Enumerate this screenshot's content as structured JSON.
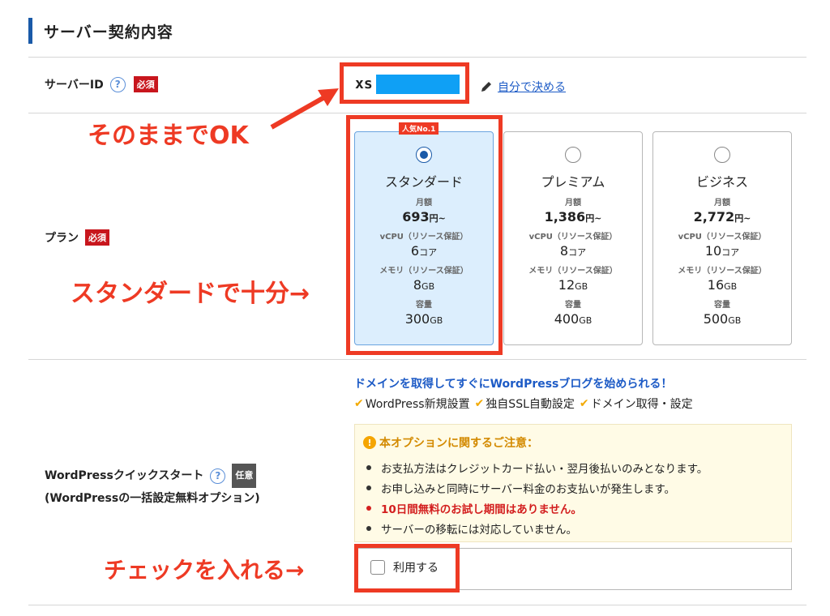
{
  "section": {
    "title": "サーバー契約内容"
  },
  "server_id": {
    "label": "サーバーID",
    "help_icon": "question-circle-icon",
    "required_badge": "必須",
    "value": "xs",
    "edit_link": "自分で決める",
    "edit_icon": "pencil-icon"
  },
  "plan": {
    "label": "プラン",
    "required_badge": "必須",
    "popular_badge": "人気No.1",
    "price_label": "月額",
    "cpu_label": "vCPU（リソース保証）",
    "memory_label": "メモリ（リソース保証）",
    "storage_label": "容量",
    "options": [
      {
        "name": "スタンダード",
        "price": "693",
        "price_unit": "円~",
        "cpu": "6",
        "cpu_unit": "コア",
        "memory": "8",
        "memory_unit": "GB",
        "storage": "300",
        "storage_unit": "GB",
        "selected": true
      },
      {
        "name": "プレミアム",
        "price": "1,386",
        "price_unit": "円~",
        "cpu": "8",
        "cpu_unit": "コア",
        "memory": "12",
        "memory_unit": "GB",
        "storage": "400",
        "storage_unit": "GB",
        "selected": false
      },
      {
        "name": "ビジネス",
        "price": "2,772",
        "price_unit": "円~",
        "cpu": "10",
        "cpu_unit": "コア",
        "memory": "16",
        "memory_unit": "GB",
        "storage": "500",
        "storage_unit": "GB",
        "selected": false
      }
    ]
  },
  "wordpress": {
    "label_line1": "WordPressクイックスタート",
    "label_line2": "(WordPressの一括設定無料オプション)",
    "optional_badge": "任意",
    "promo": "ドメインを取得してすぐにWordPressブログを始められる！",
    "features": [
      "WordPress新規設置",
      "独自SSL自動設定",
      "ドメイン取得・設定"
    ],
    "notice_title": "本オプションに関するご注意：",
    "notice_items": [
      "お支払方法はクレジットカード払い・翌月後払いのみとなります。",
      "お申し込みと同時にサーバー料金のお支払いが発生します。",
      "10日間無料のお試し期間はありません。",
      "サーバーの移転には対応していません。"
    ],
    "checkbox_label": "利用する",
    "checked": false
  },
  "annotations": {
    "server_id": "そのままでOK",
    "plan": "スタンダードで十分→",
    "checkbox": "チェックを入れる→"
  },
  "colors": {
    "accent": "#1a5aa8",
    "required": "#c8161d",
    "annotation": "#ee3a24",
    "mask": "#0fa0f5",
    "selected_card": "#dceefd"
  }
}
